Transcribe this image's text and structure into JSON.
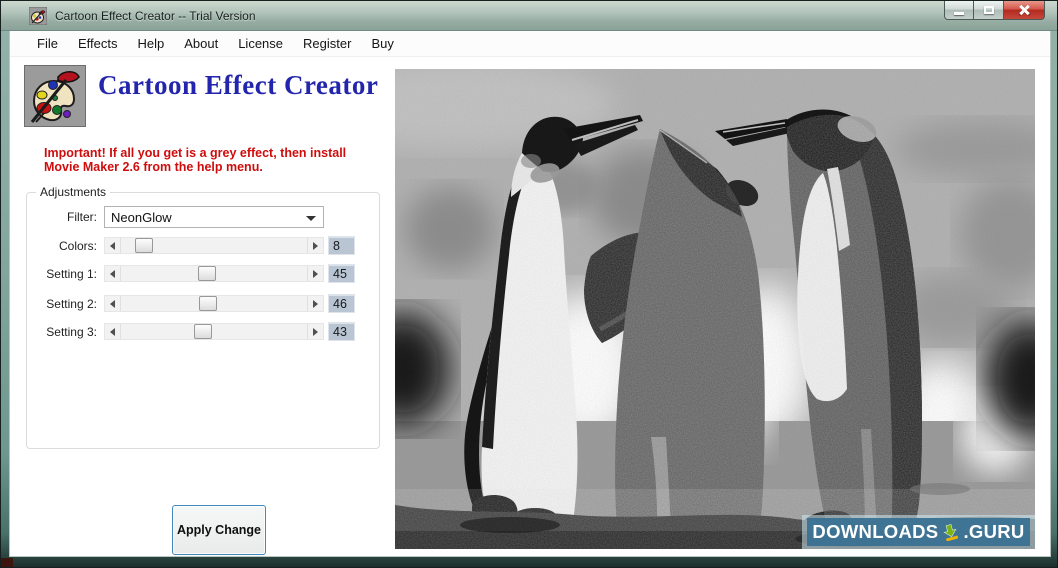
{
  "window": {
    "title": "Cartoon Effect Creator -- Trial Version"
  },
  "menu": {
    "items": [
      "File",
      "Effects",
      "Help",
      "About",
      "License",
      "Register",
      "Buy"
    ]
  },
  "brand": {
    "title": "Cartoon Effect Creator"
  },
  "warning": {
    "line1": "Important! If all you get is a grey effect, then install",
    "line2": "Movie Maker 2.6 from the help menu."
  },
  "adjustments": {
    "group_label": "Adjustments",
    "filter": {
      "label": "Filter:",
      "value": "NeonGlow"
    },
    "sliders": [
      {
        "label": "Colors:",
        "value": "8"
      },
      {
        "label": "Setting 1:",
        "value": "45"
      },
      {
        "label": "Setting 2:",
        "value": "46"
      },
      {
        "label": "Setting 3:",
        "value": "43"
      }
    ],
    "apply_label": "Apply Change"
  },
  "preview": {
    "description": "Grayscale NeonGlow cartoon effect applied to photo of three king penguins"
  },
  "watermark": {
    "brand": "DOWNLOADS",
    "tld": ".GURU"
  },
  "colors": {
    "brand_blue": "#2326ad",
    "warning_red": "#cf0d0d",
    "value_box_bg": "#b9c5d2",
    "button_border_blue": "#4388bb",
    "watermark_band": "#387092",
    "titlebar_glass": "#b1c3ba"
  }
}
